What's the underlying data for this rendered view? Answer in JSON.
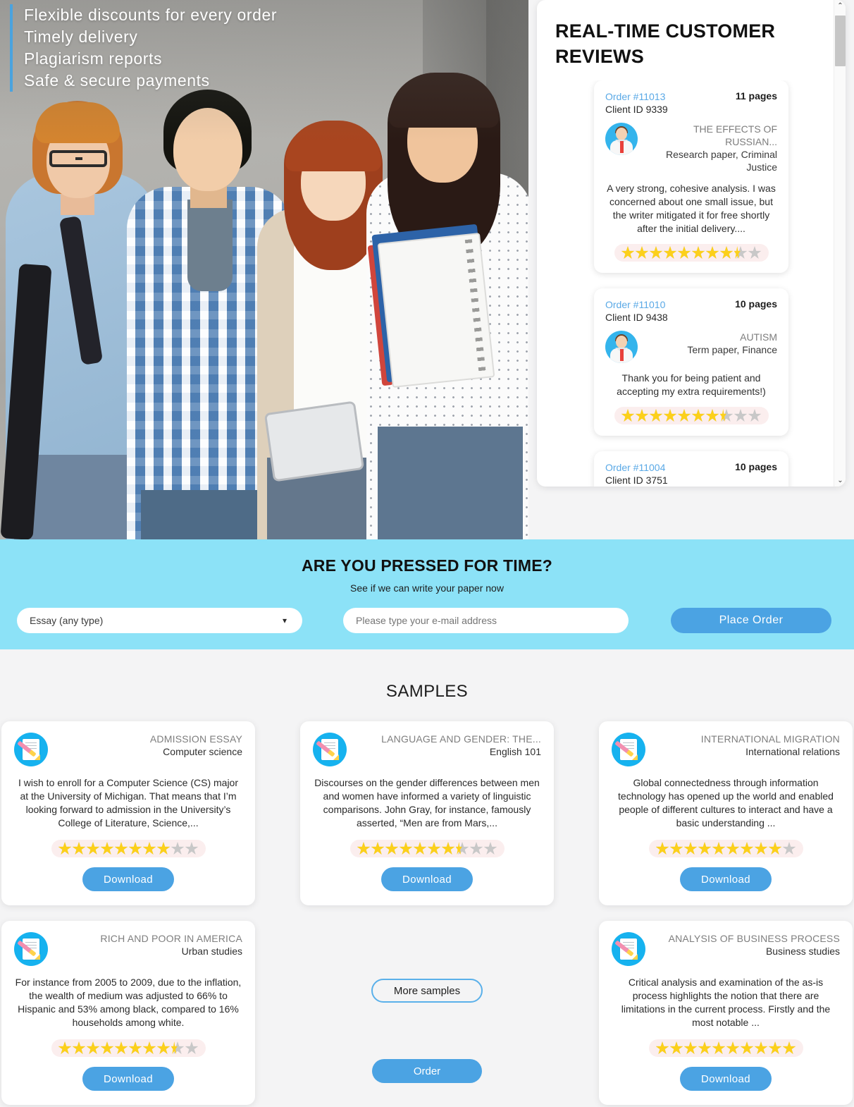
{
  "hero": {
    "bullets": [
      "Flexible discounts for every order",
      "Timely delivery",
      "Plagiarism reports",
      "Safe & secure payments"
    ],
    "accent_color": "#4aa3df"
  },
  "reviews": {
    "title": "REAL-TIME CUSTOMER REVIEWS",
    "order_link_color": "#5aa9e6",
    "star_filled_color": "#fcd01b",
    "star_empty_color": "#c8c8c8",
    "items": [
      {
        "order": "Order #11013",
        "client": "Client ID 9339",
        "pages": "11 pages",
        "topic": "THE EFFECTS OF RUSSIAN...",
        "type": "Research paper, Criminal Justice",
        "text": "A very strong, cohesive analysis. I was concerned about one small issue, but the writer mitigated it for free shortly after the initial delivery....",
        "rating": 8.5,
        "rating_max": 10,
        "avatar": "user-avatar-icon"
      },
      {
        "order": "Order #11010",
        "client": "Client ID 9438",
        "pages": "10 pages",
        "topic": "AUTISM",
        "type": "Term paper, Finance",
        "text": "Thank you for being patient and accepting my extra requirements!)",
        "rating": 7.5,
        "rating_max": 10,
        "avatar": "user-avatar-icon"
      },
      {
        "order": "Order #11004",
        "client": "Client ID 3751",
        "pages": "10 pages",
        "topic": "",
        "type": "",
        "text": "",
        "rating": 0,
        "rating_max": 10,
        "avatar": "user-avatar-icon"
      }
    ]
  },
  "order_strip": {
    "title": "ARE YOU PRESSED FOR TIME?",
    "subtitle": "See if we can write your paper now",
    "paper_type_value": "Essay (any type)",
    "email_placeholder": "Please type your e-mail address",
    "email_value": "",
    "button_label": "Place Order",
    "background_color": "#8ce2f7",
    "button_color": "#4ba3e3"
  },
  "samples": {
    "title": "SAMPLES",
    "more_label": "More samples",
    "order_label": "Order",
    "download_label": "Download",
    "cards": [
      {
        "title": "ADMISSION ESSAY",
        "subject": "Computer science",
        "text": "I wish to enroll for a Computer Science (CS) major at the University of Michigan. That means that I’m looking forward to admission in the University’s College of Literature, Science,...",
        "rating": 8,
        "rating_max": 10,
        "button": "Download"
      },
      {
        "title": "LANGUAGE AND GENDER: THE...",
        "subject": "English 101",
        "text": "Discourses on the gender differences between men and women have informed a variety of linguistic comparisons. John Gray, for instance, famously asserted, “Men are from Mars,...",
        "rating": 7.5,
        "rating_max": 10,
        "button": "Download"
      },
      {
        "title": "INTERNATIONAL MIGRATION",
        "subject": "International relations",
        "text": "Global connectedness through information technology has opened up the world and enabled people of different cultures to interact and have a basic understanding ...",
        "rating": 9,
        "rating_max": 10,
        "button": "Download"
      },
      {
        "title": "RICH AND POOR IN AMERICA",
        "subject": "Urban studies",
        "text": "For instance from 2005 to 2009, due to the inflation, the wealth of medium was adjusted to 66% to Hispanic and 53% among black, compared to 16% households among white.",
        "rating": 8.5,
        "rating_max": 10,
        "button": "Download"
      },
      {
        "title": "ANALYSIS OF BUSINESS PROCESS",
        "subject": "Business studies",
        "text": "Critical analysis and examination of the as-is process highlights the notion that there are limitations in the current process. Firstly and the most notable ...",
        "rating": 10,
        "rating_max": 10,
        "button": "Download"
      }
    ]
  },
  "scrollbar": {
    "up_glyph": "⌃",
    "down_glyph": "⌄"
  }
}
